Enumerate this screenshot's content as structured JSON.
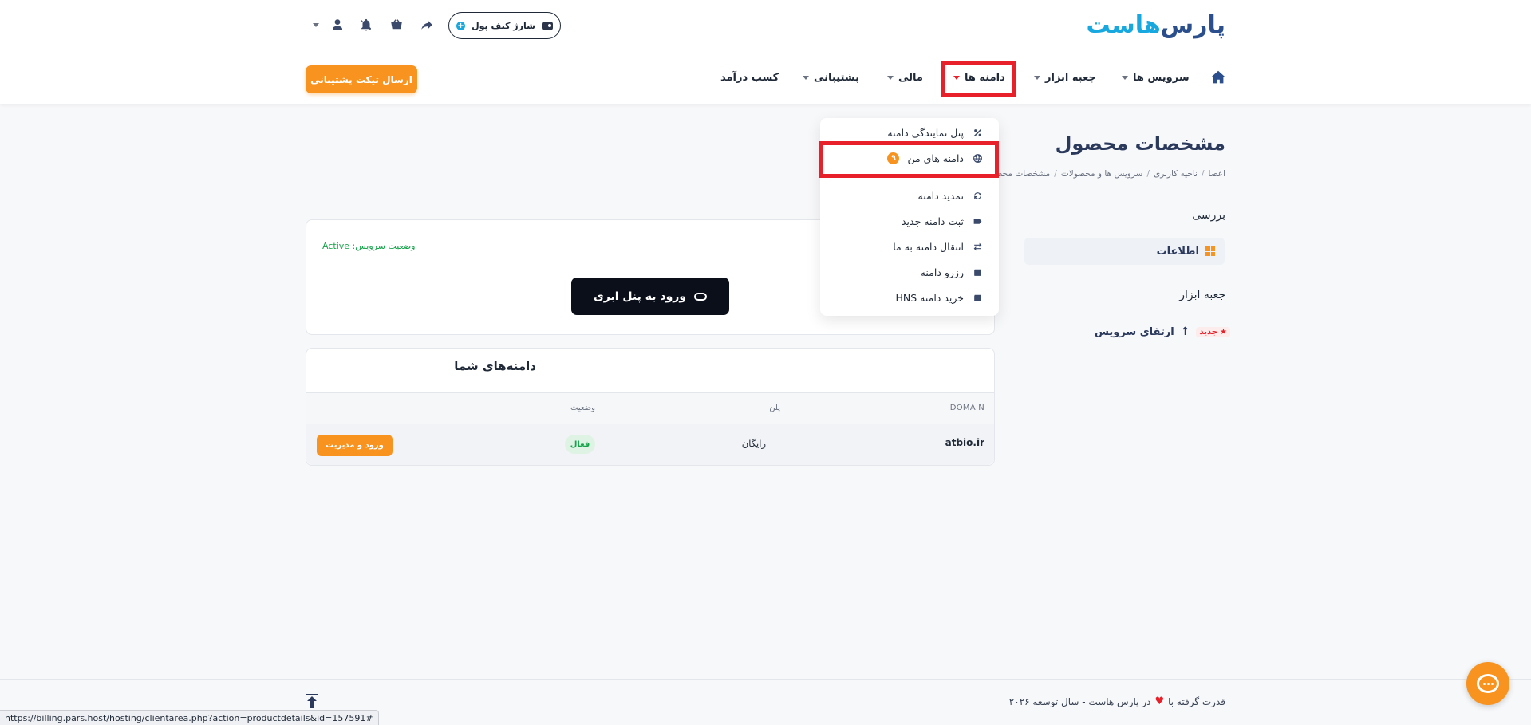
{
  "header": {
    "logo_main": "پارس",
    "logo_accent": "هاست",
    "wallet_label": "شارژ کیف پول",
    "ticket_button": "ارسال تیکت پشتیبانی"
  },
  "nav": {
    "items": [
      {
        "label": "سرویس ها"
      },
      {
        "label": "جعبه ابزار"
      },
      {
        "label": "دامنه ها"
      },
      {
        "label": "مالی"
      },
      {
        "label": "پشتیبانی"
      },
      {
        "label": "کسب درآمد"
      }
    ]
  },
  "dropdown": {
    "items": [
      {
        "label": "پنل نمایندگی دامنه",
        "icon": "percent-icon"
      },
      {
        "label": "دامنه های من",
        "icon": "globe-icon",
        "badge": "۹"
      },
      {
        "label": "تمدید دامنه",
        "icon": "refresh-icon"
      },
      {
        "label": "ثبت دامنه جدید",
        "icon": "tag-icon"
      },
      {
        "label": "انتقال دامنه به ما",
        "icon": "transfer-icon"
      },
      {
        "label": "رزرو دامنه",
        "icon": "box-icon"
      },
      {
        "label": "خرید دامنه HNS",
        "icon": "box-icon"
      }
    ]
  },
  "page": {
    "title": "مشخصات محصول",
    "breadcrumb": [
      "اعضا",
      "ناحیه کاربری",
      "سرویس ها و محصولات",
      "مشخصات محص"
    ]
  },
  "sidebar": {
    "review_heading": "بررسی",
    "info_label": "اطلاعات",
    "toolbox_heading": "جعبه ابزار",
    "upgrade_label": "ارتقای سرویس",
    "new_badge": "جدید"
  },
  "service": {
    "status": "وضعیت سرویس: Active",
    "cloud_button": "ورود به پنل ابری"
  },
  "domains_table": {
    "title": "دامنه‌های شما",
    "headers": {
      "domain": "DOMAIN",
      "plan": "پلن",
      "status": "وضعیت"
    },
    "rows": [
      {
        "domain": "atbio.ir",
        "plan": "رایگان",
        "status": "فعال",
        "action": "ورود و مدیریت"
      }
    ]
  },
  "footer": {
    "powered_prefix": "قدرت گرفته با",
    "powered_suffix": "در پارس هاست - سال توسعه ۲۰۲۶"
  },
  "status_bar_url": "https://billing.pars.host/hosting/clientarea.php?action=productdetails&id=157591#",
  "colors": {
    "accent": "#f7931e",
    "brand": "#2b4f8c",
    "highlight": "#e8202a",
    "active_green": "#16a34a"
  }
}
